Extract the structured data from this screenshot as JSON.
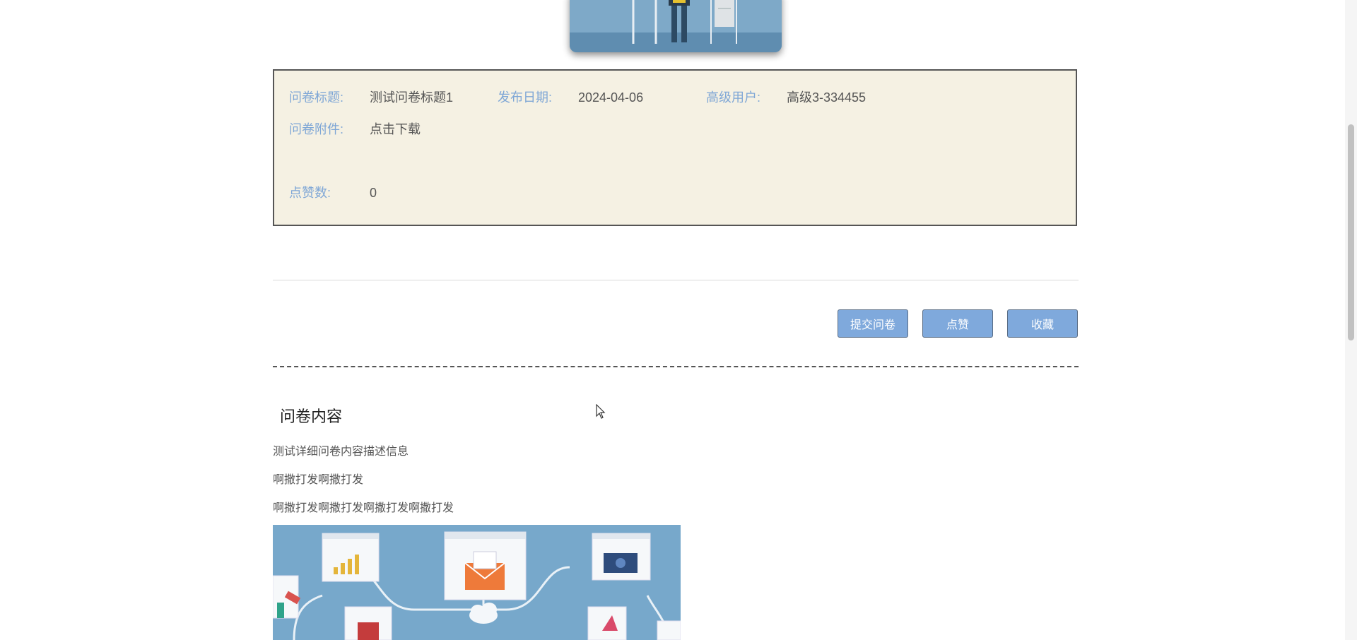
{
  "info": {
    "title_label": "问卷标题:",
    "title_value": "测试问卷标题1",
    "date_label": "发布日期:",
    "date_value": "2024-04-06",
    "user_label": "高级用户:",
    "user_value": "高级3-334455",
    "attachment_label": "问卷附件:",
    "attachment_value": "点击下载",
    "likes_label": "点赞数:",
    "likes_value": "0"
  },
  "actions": {
    "submit_label": "提交问卷",
    "like_label": "点赞",
    "favorite_label": "收藏"
  },
  "content": {
    "section_title": "问卷内容",
    "paragraphs": [
      "测试详细问卷内容描述信息",
      "啊撒打发啊撒打发",
      "啊撒打发啊撒打发啊撒打发啊撒打发"
    ]
  },
  "colors": {
    "label": "#7fa7d6",
    "button": "#7fa9dc",
    "info_bg": "#f5f1e3"
  },
  "icons": {
    "cursor": "arrow-cursor-icon"
  }
}
